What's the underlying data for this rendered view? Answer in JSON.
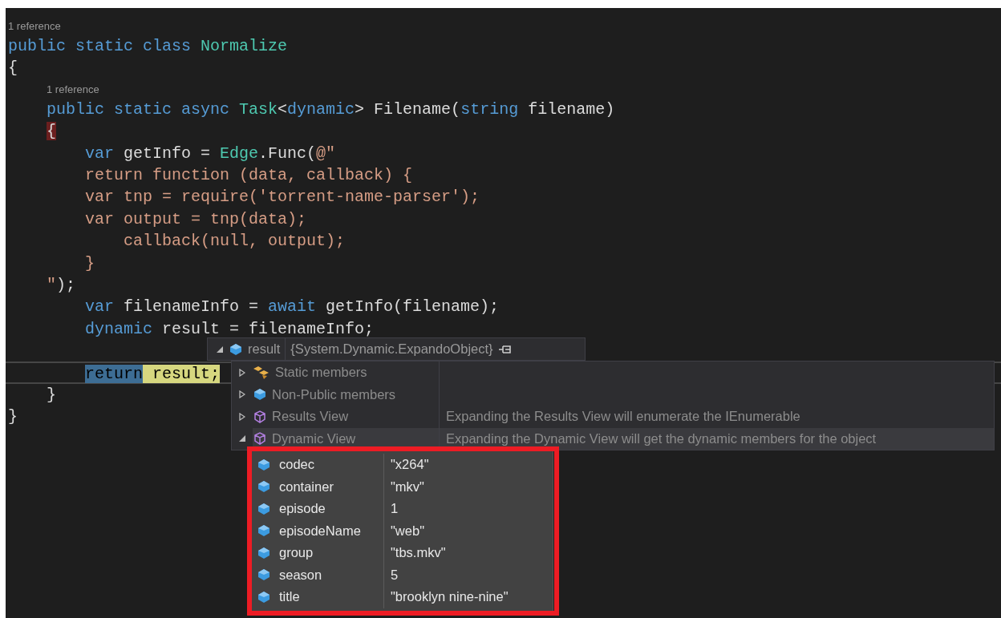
{
  "editor": {
    "lines": [
      {
        "kind": "codelens",
        "text": "1 reference"
      },
      {
        "kind": "code",
        "tokens": [
          {
            "kind": "keyword",
            "text": "public static class "
          },
          {
            "kind": "type",
            "text": "Normalize"
          }
        ]
      },
      {
        "kind": "code",
        "tokens": [
          {
            "kind": "plain",
            "text": "{"
          }
        ]
      },
      {
        "kind": "codelens",
        "text": "1 reference"
      },
      {
        "kind": "code",
        "tokens": [
          {
            "kind": "keyword",
            "text": "    public static async "
          },
          {
            "kind": "type",
            "text": "Task"
          },
          {
            "kind": "plain",
            "text": "<"
          },
          {
            "kind": "keyword",
            "text": "dynamic"
          },
          {
            "kind": "plain",
            "text": "> Filename("
          },
          {
            "kind": "keyword",
            "text": "string"
          },
          {
            "kind": "plain",
            "text": " filename)"
          }
        ]
      },
      {
        "kind": "code",
        "tokens": [
          {
            "kind": "plain",
            "text": "    {",
            "brace_match": true
          }
        ]
      },
      {
        "kind": "code",
        "tokens": [
          {
            "kind": "keyword",
            "text": "        var"
          },
          {
            "kind": "plain",
            "text": " getInfo = "
          },
          {
            "kind": "type",
            "text": "Edge"
          },
          {
            "kind": "plain",
            "text": ".Func("
          },
          {
            "kind": "string",
            "text": "@\""
          }
        ]
      },
      {
        "kind": "code",
        "tokens": [
          {
            "kind": "string",
            "text": "        return function (data, callback) {"
          }
        ]
      },
      {
        "kind": "code",
        "tokens": [
          {
            "kind": "string",
            "text": "        var tnp = require('torrent-name-parser');"
          }
        ]
      },
      {
        "kind": "code",
        "tokens": [
          {
            "kind": "string",
            "text": "        var output = tnp(data);"
          }
        ]
      },
      {
        "kind": "code",
        "tokens": [
          {
            "kind": "string",
            "text": "            callback(null, output);"
          }
        ]
      },
      {
        "kind": "code",
        "tokens": [
          {
            "kind": "string",
            "text": "        }"
          }
        ]
      },
      {
        "kind": "code",
        "tokens": [
          {
            "kind": "string",
            "text": "    \""
          },
          {
            "kind": "plain",
            "text": ");"
          }
        ]
      },
      {
        "kind": "code",
        "tokens": [
          {
            "kind": "keyword",
            "text": "        var"
          },
          {
            "kind": "plain",
            "text": " filenameInfo = "
          },
          {
            "kind": "keyword",
            "text": "await"
          },
          {
            "kind": "plain",
            "text": " getInfo(filename);"
          }
        ]
      },
      {
        "kind": "code",
        "tokens": [
          {
            "kind": "keyword",
            "text": "        dynamic"
          },
          {
            "kind": "plain",
            "text": " result = filenameInfo;"
          }
        ]
      },
      {
        "kind": "code"
      },
      {
        "kind": "code",
        "current": true,
        "tokens": [
          {
            "kind": "keyword",
            "text": "        return",
            "selected": true
          },
          {
            "kind": "plain",
            "text": " result;",
            "current_statement": true
          }
        ]
      },
      {
        "kind": "code",
        "tokens": [
          {
            "kind": "plain",
            "text": "    }"
          }
        ]
      },
      {
        "kind": "code",
        "tokens": [
          {
            "kind": "plain",
            "text": "}"
          }
        ]
      }
    ]
  },
  "datatip": {
    "name": "result",
    "value": "{System.Dynamic.ExpandoObject}",
    "expanded": true,
    "members": [
      {
        "kind": "static",
        "name": "Static members",
        "expanded": false,
        "selected": false
      },
      {
        "kind": "field",
        "name": "Non-Public members",
        "expanded": false,
        "selected": false
      },
      {
        "kind": "view",
        "name": "Results View",
        "description": "Expanding the Results View will enumerate the IEnumerable",
        "expanded": false,
        "selected": false
      },
      {
        "kind": "view",
        "name": "Dynamic View",
        "description": "Expanding the Dynamic View will get the dynamic members for the object",
        "expanded": true,
        "selected": true,
        "children": [
          {
            "name": "codec",
            "value": "\"x264\""
          },
          {
            "name": "container",
            "value": "\"mkv\""
          },
          {
            "name": "episode",
            "value": "1"
          },
          {
            "name": "episodeName",
            "value": "\"web\""
          },
          {
            "name": "group",
            "value": "\"tbs.mkv\""
          },
          {
            "name": "season",
            "value": "5"
          },
          {
            "name": "title",
            "value": "\"brooklyn nine-nine\""
          }
        ]
      }
    ]
  }
}
